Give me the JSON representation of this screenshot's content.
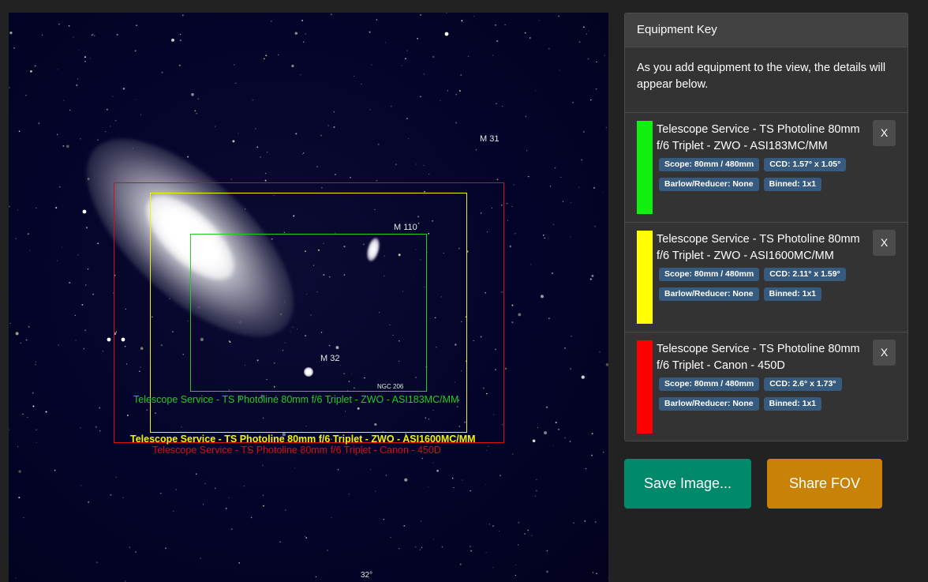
{
  "sky": {
    "objects": {
      "m31": "M 31",
      "m110": "M 110",
      "m32": "M 32",
      "ngc206": "NGC 206",
      "v_marker": "v",
      "dec_label": "32°"
    },
    "fov_labels": {
      "green": "Telescope Service - TS Photoline 80mm f/6 Triplet - ZWO - ASI183MC/MM",
      "yellow": "Telescope Service - TS Photoline 80mm f/6 Triplet - ZWO - ASI1600MC/MM",
      "red": "Telescope Service - TS Photoline 80mm f/6 Triplet - Canon - 450D"
    },
    "colors": {
      "green": "#22cc22",
      "yellow": "#f3f300",
      "red": "#d41010"
    }
  },
  "panel": {
    "title": "Equipment Key",
    "intro": "As you add equipment to the view, the details will appear below.",
    "items": [
      {
        "title": "Telescope Service - TS Photoline 80mm f/6 Triplet - ZWO - ASI183MC/MM",
        "color": "#0ff00f",
        "scope": "Scope: 80mm / 480mm",
        "ccd": "CCD: 1.57° x 1.05°",
        "barlow": "Barlow/Reducer: None",
        "binned": "Binned: 1x1",
        "remove": "X"
      },
      {
        "title": "Telescope Service - TS Photoline 80mm f/6 Triplet - ZWO - ASI1600MC/MM",
        "color": "#ffff00",
        "scope": "Scope: 80mm / 480mm",
        "ccd": "CCD: 2.11° x 1.59°",
        "barlow": "Barlow/Reducer: None",
        "binned": "Binned: 1x1",
        "remove": "X"
      },
      {
        "title": "Telescope Service - TS Photoline 80mm f/6 Triplet - Canon - 450D",
        "color": "#ff0000",
        "scope": "Scope: 80mm / 480mm",
        "ccd": "CCD: 2.6° x 1.73°",
        "barlow": "Barlow/Reducer: None",
        "binned": "Binned: 1x1",
        "remove": "X"
      }
    ]
  },
  "buttons": {
    "save": "Save Image...",
    "share": "Share FOV",
    "save_color": "#00896a",
    "share_color": "#c98208"
  }
}
